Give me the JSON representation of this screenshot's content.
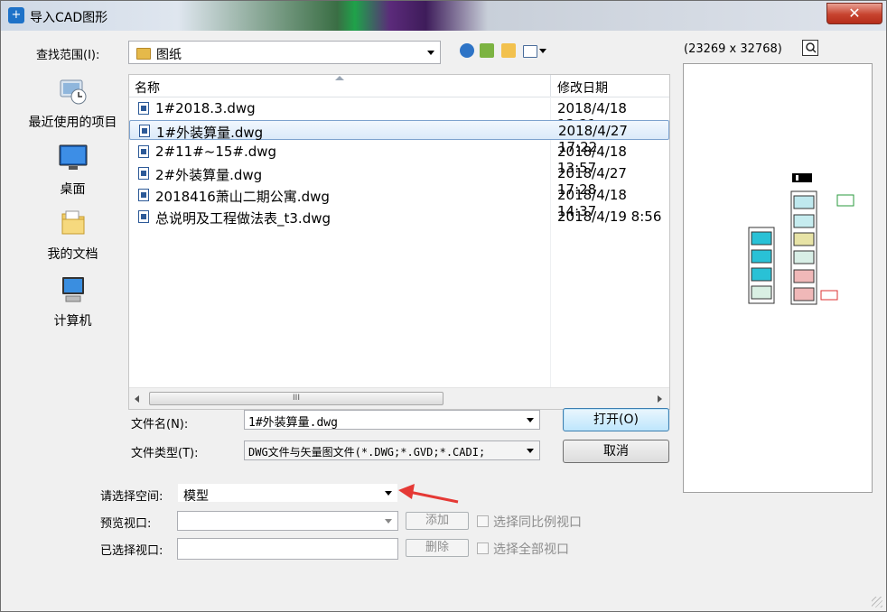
{
  "window": {
    "title": "导入CAD图形",
    "close_label": "✕"
  },
  "lookin": {
    "label": "查找范围(I):",
    "value": "图纸"
  },
  "places": [
    {
      "label": "最近使用的项目",
      "icon": "recent-items-icon"
    },
    {
      "label": "桌面",
      "icon": "desktop-icon"
    },
    {
      "label": "我的文档",
      "icon": "documents-folder-icon"
    },
    {
      "label": "计算机",
      "icon": "computer-icon"
    }
  ],
  "list": {
    "col_name": "名称",
    "col_date": "修改日期",
    "scroll_grip": "III",
    "files": [
      {
        "name": "1#2018.3.dwg",
        "date": "2018/4/18 13:21",
        "selected": false
      },
      {
        "name": "1#外装算量.dwg",
        "date": "2018/4/27 17:22",
        "selected": true
      },
      {
        "name": "2#11#~15#.dwg",
        "date": "2018/4/18 13:57",
        "selected": false
      },
      {
        "name": "2#外装算量.dwg",
        "date": "2018/4/27 17:28",
        "selected": false
      },
      {
        "name": "2018416萧山二期公寓.dwg",
        "date": "2018/4/18 14:37",
        "selected": false
      },
      {
        "name": "总说明及工程做法表_t3.dwg",
        "date": "2018/4/19 8:56",
        "selected": false
      }
    ]
  },
  "filename": {
    "label": "文件名(N):",
    "value": "1#外装算量.dwg"
  },
  "filetype": {
    "label": "文件类型(T):",
    "value": "DWG文件与矢量图文件(*.DWG;*.GVD;*.CADI;"
  },
  "buttons": {
    "open": "打开(O)",
    "cancel": "取消",
    "add": "添加",
    "delete": "删除"
  },
  "space": {
    "label": "请选择空间:",
    "value": "模型"
  },
  "viewport": {
    "label": "预览视口:",
    "value": ""
  },
  "selected_viewport": {
    "label": "已选择视口:",
    "value": ""
  },
  "checkboxes": {
    "same_scale": "选择同比例视口",
    "all": "选择全部视口"
  },
  "preview": {
    "dimensions": "(23269 x 32768)"
  },
  "colors": {
    "accent_red": "#e53935",
    "selection_border": "#7da2ce"
  }
}
